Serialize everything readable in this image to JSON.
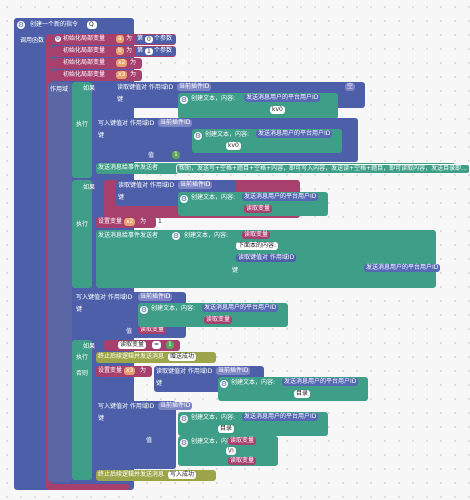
{
  "header": {
    "title": "创建一个新的指令",
    "badge": "Q"
  },
  "labels": {
    "call_params": "调用函数",
    "scope": "作用域",
    "if": "如果",
    "do": "执行",
    "else": "否则",
    "key": "键",
    "value": "值",
    "as": "为",
    "init_var": "初始化局部变量",
    "set_var": "设置变量",
    "read_var": "读取变量",
    "write_kv": "写入键值对 作用域ID",
    "read_kv": "读取键值对 作用域ID",
    "current_plugin_id": "当前插件ID",
    "create_text": "创建文本，内容:",
    "send_user_platform_id": "发送消息用户的平台用户ID",
    "empty": "空",
    "nth_param": "第",
    "param_suffix": "个参数",
    "send_to_sender": "发送消息给事件发送者",
    "stop_send": "终止后续逻辑并发送消息",
    "eq": "=",
    "plus": "+"
  },
  "vars": {
    "a": "a",
    "b": "b",
    "c": "c",
    "x1": "x1",
    "x2": "x2",
    "x3": "x3",
    "kv0": "kv0"
  },
  "nums": {
    "zero": "0",
    "one": "1"
  },
  "strings": {
    "help": "帮助，发送写+空格+题目+空格+内容，即可写入内容，发送读+空格+题目，即可读取内容，发送目录即...",
    "not_found": "下面本的内容:",
    "quote_open": "“",
    "quote_close": "”",
    "write_success": "写入成功",
    "catalog": "目录",
    "newline": "\\n",
    "gen_success": "赠送成功"
  },
  "colors": {
    "main": "#4c5fa8",
    "pink": "#a8406d",
    "teal": "#3f9e87",
    "olive": "#9da54a",
    "orange": "#d78a35",
    "green": "#5aa65c"
  }
}
